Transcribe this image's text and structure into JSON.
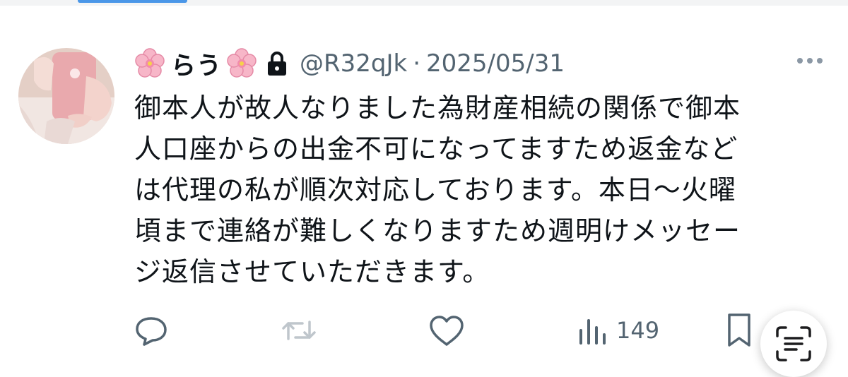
{
  "window": {
    "accent_color": "#4b97e8"
  },
  "post": {
    "author": {
      "display_name": "らう",
      "handle": "@R32qJk",
      "protected": true,
      "name_emoji": "cherry-blossom"
    },
    "separator": "·",
    "date": "2025/05/31",
    "text_lines": [
      "御本人が故人なりました為財産相続の関係で御本",
      "人口座からの出金不可になってますため返金など",
      "は代理の私が順次対応しております。本日〜火曜",
      "頃まで連絡が難しくなりますため週明けメッセー",
      "ジ返信させていただきます。"
    ],
    "actions": {
      "views_count": "149",
      "icons": [
        "reply-icon",
        "repost-icon",
        "like-icon",
        "views-icon",
        "bookmark-icon"
      ]
    }
  },
  "colors": {
    "text": "#0f1419",
    "muted": "#536471"
  }
}
